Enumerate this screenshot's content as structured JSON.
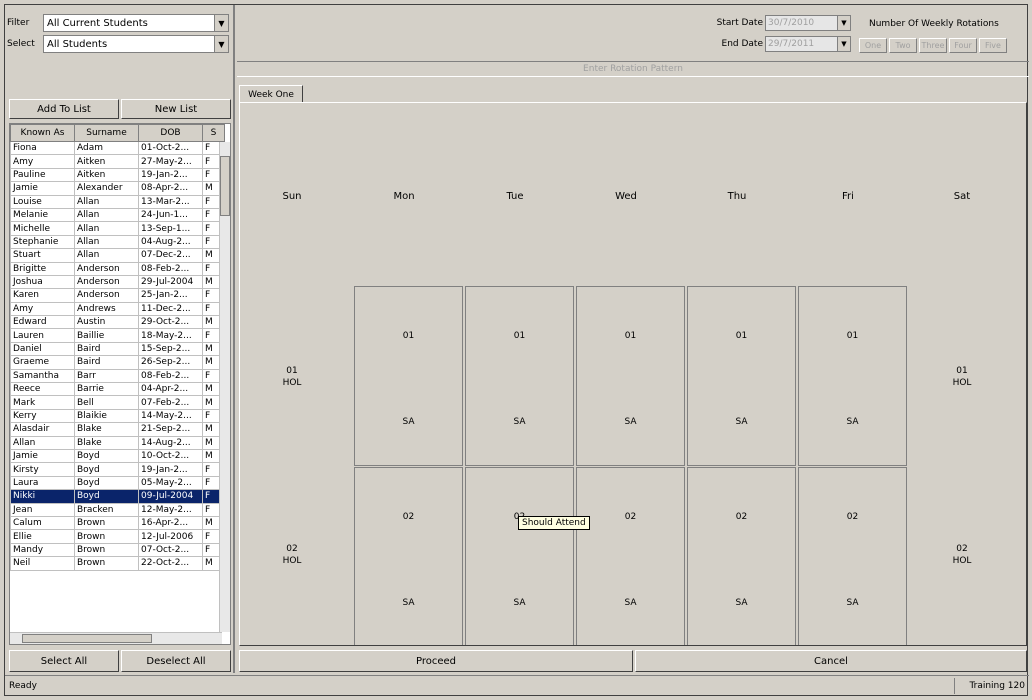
{
  "filter": {
    "label": "Filter",
    "value": "All Current Students"
  },
  "select": {
    "label": "Select",
    "value": "All Students"
  },
  "buttons": {
    "add_to_list": "Add To List",
    "new_list": "New List",
    "select_all": "Select All",
    "deselect_all": "Deselect All",
    "proceed": "Proceed",
    "cancel": "Cancel"
  },
  "table": {
    "headers": [
      "Known As",
      "Surname",
      "DOB",
      "S"
    ],
    "rows": [
      [
        "Fiona",
        "Adam",
        "01-Oct-2...",
        "F"
      ],
      [
        "Amy",
        "Aitken",
        "27-May-2...",
        "F"
      ],
      [
        "Pauline",
        "Aitken",
        "19-Jan-2...",
        "F"
      ],
      [
        "Jamie",
        "Alexander",
        "08-Apr-2...",
        "M"
      ],
      [
        "Louise",
        "Allan",
        "13-Mar-2...",
        "F"
      ],
      [
        "Melanie",
        "Allan",
        "24-Jun-1...",
        "F"
      ],
      [
        "Michelle",
        "Allan",
        "13-Sep-1...",
        "F"
      ],
      [
        "Stephanie",
        "Allan",
        "04-Aug-2...",
        "F"
      ],
      [
        "Stuart",
        "Allan",
        "07-Dec-2...",
        "M"
      ],
      [
        "Brigitte",
        "Anderson",
        "08-Feb-2...",
        "F"
      ],
      [
        "Joshua",
        "Anderson",
        "29-Jul-2004",
        "M"
      ],
      [
        "Karen",
        "Anderson",
        "25-Jan-2...",
        "F"
      ],
      [
        "Amy",
        "Andrews",
        "11-Dec-2...",
        "F"
      ],
      [
        "Edward",
        "Austin",
        "29-Oct-2...",
        "M"
      ],
      [
        "Lauren",
        "Baillie",
        "18-May-2...",
        "F"
      ],
      [
        "Daniel",
        "Baird",
        "15-Sep-2...",
        "M"
      ],
      [
        "Graeme",
        "Baird",
        "26-Sep-2...",
        "M"
      ],
      [
        "Samantha",
        "Barr",
        "08-Feb-2...",
        "F"
      ],
      [
        "Reece",
        "Barrie",
        "04-Apr-2...",
        "M"
      ],
      [
        "Mark",
        "Bell",
        "07-Feb-2...",
        "M"
      ],
      [
        "Kerry",
        "Blaikie",
        "14-May-2...",
        "F"
      ],
      [
        "Alasdair",
        "Blake",
        "21-Sep-2...",
        "M"
      ],
      [
        "Allan",
        "Blake",
        "14-Aug-2...",
        "M"
      ],
      [
        "Jamie",
        "Boyd",
        "10-Oct-2...",
        "M"
      ],
      [
        "Kirsty",
        "Boyd",
        "19-Jan-2...",
        "F"
      ],
      [
        "Laura",
        "Boyd",
        "05-May-2...",
        "F"
      ],
      [
        "Nikki",
        "Boyd",
        "09-Jul-2004",
        "F"
      ],
      [
        "Jean",
        "Bracken",
        "12-May-2...",
        "F"
      ],
      [
        "Calum",
        "Brown",
        "16-Apr-2...",
        "M"
      ],
      [
        "Ellie",
        "Brown",
        "12-Jul-2006",
        "F"
      ],
      [
        "Mandy",
        "Brown",
        "07-Oct-2...",
        "F"
      ],
      [
        "Neil",
        "Brown",
        "22-Oct-2...",
        "M"
      ]
    ],
    "selected_index": 26
  },
  "dates": {
    "start_label": "Start Date",
    "start_value": "30/7/2010",
    "end_label": "End Date",
    "end_value": "29/7/2011"
  },
  "rotations": {
    "title": "Number Of Weekly Rotations",
    "options": [
      "One",
      "Two",
      "Three",
      "Four",
      "Five"
    ]
  },
  "enter_pattern": "Enter Rotation Pattern",
  "tab": "Week One",
  "days": [
    "Sun",
    "Mon",
    "Tue",
    "Wed",
    "Thu",
    "Fri",
    "Sat"
  ],
  "week": {
    "row1_code": "01",
    "row1_sub": "SA",
    "row2_code": "02",
    "row2_sub": "SA",
    "hol1": [
      "01",
      "HOL"
    ],
    "hol2": [
      "02",
      "HOL"
    ]
  },
  "tooltip": "Should Attend",
  "status": {
    "left": "Ready",
    "right": "Training 120"
  }
}
